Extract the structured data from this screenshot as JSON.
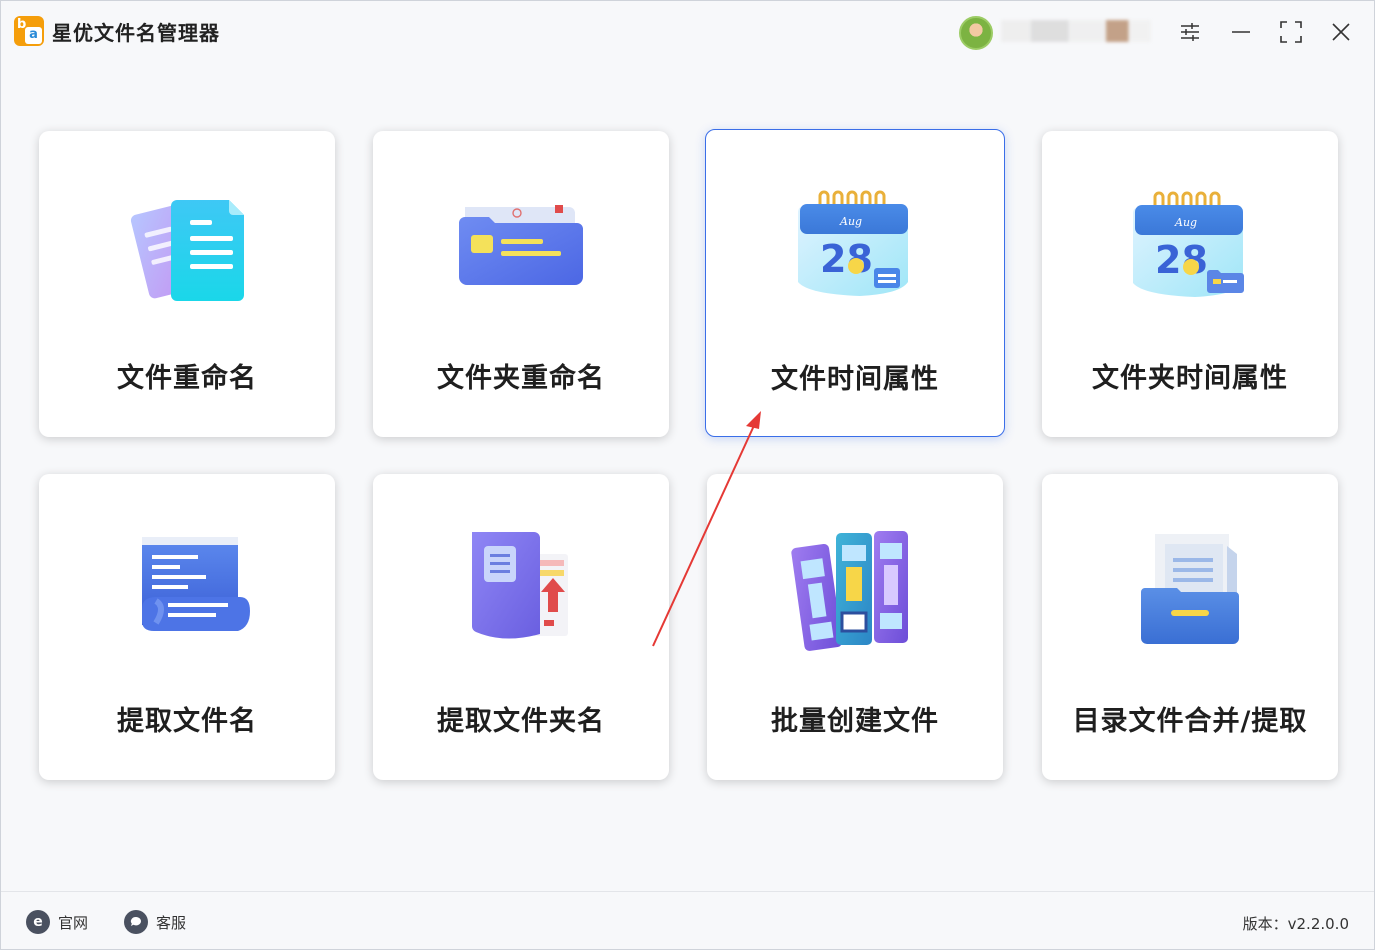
{
  "app": {
    "title": "星优文件名管理器",
    "user_name": "",
    "logo_letters": {
      "b": "b",
      "a": "a"
    }
  },
  "window_controls": {
    "settings": "settings-icon",
    "minimize": "minimize-icon",
    "maximize": "maximize-icon",
    "close": "close-icon"
  },
  "cards": [
    {
      "label": "文件重命名",
      "icon": "file-rename-icon"
    },
    {
      "label": "文件夹重命名",
      "icon": "folder-rename-icon"
    },
    {
      "label": "文件时间属性",
      "icon": "file-calendar-icon",
      "selected": true,
      "calendar_month": "Aug",
      "calendar_day": "28"
    },
    {
      "label": "文件夹时间属性",
      "icon": "folder-calendar-icon",
      "calendar_month": "Aug",
      "calendar_day": "28"
    },
    {
      "label": "提取文件名",
      "icon": "extract-filename-icon"
    },
    {
      "label": "提取文件夹名",
      "icon": "extract-foldername-icon"
    },
    {
      "label": "批量创建文件",
      "icon": "batch-create-icon"
    },
    {
      "label": "目录文件合并/提取",
      "icon": "directory-merge-icon"
    }
  ],
  "footer": {
    "website_label": "官网",
    "website_icon_glyph": "e",
    "support_label": "客服",
    "version_text": "版本：v2.2.0.0"
  },
  "colors": {
    "accent": "#3a6ee8",
    "arrow": "#e53935",
    "logo": "#f59e0b"
  }
}
